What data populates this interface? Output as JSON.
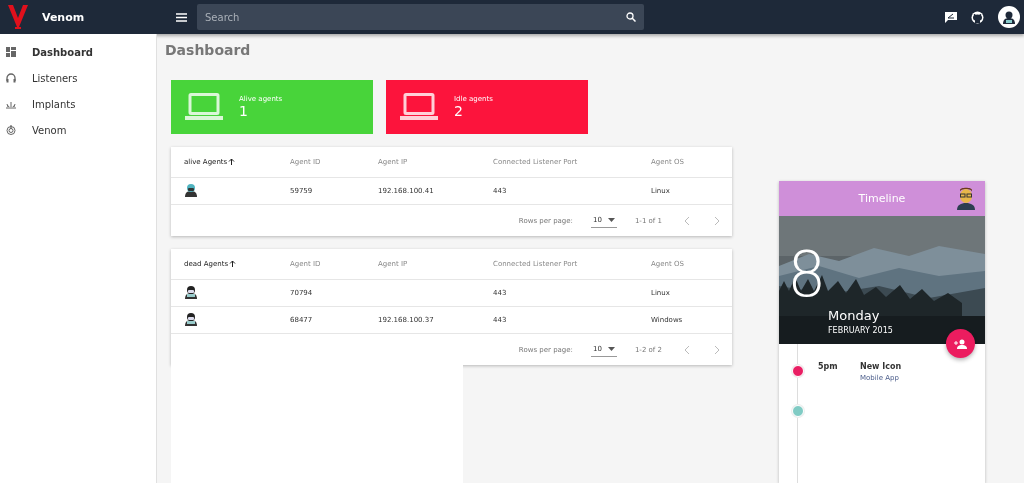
{
  "app": {
    "name": "Venom"
  },
  "search": {
    "placeholder": "Search"
  },
  "sidebar": {
    "items": [
      {
        "label": "Dashboard",
        "kind": "dashboard",
        "selected": true
      },
      {
        "label": "Listeners",
        "kind": "headphones",
        "selected": false
      },
      {
        "label": "Implants",
        "kind": "implant",
        "selected": false
      },
      {
        "label": "Venom",
        "kind": "venom",
        "selected": false
      }
    ]
  },
  "page_title": "Dashboard",
  "stat_cards": [
    {
      "label": "Alive agents",
      "value": "1",
      "color": "#48d43a"
    },
    {
      "label": "Idle agents",
      "value": "2",
      "color": "#fc143c"
    }
  ],
  "tables": [
    {
      "columns": [
        "alive Agents",
        "Agent ID",
        "Agent IP",
        "Connected Listener Port",
        "Agent OS"
      ],
      "rows": [
        {
          "id": "59759",
          "ip": "192.168.100.41",
          "port": "443",
          "os": "Linux",
          "kind": "alive"
        }
      ],
      "rows_per_page_label": "Rows per page:",
      "rows_per_page": "10",
      "range": "1-1 of 1"
    },
    {
      "columns": [
        "dead Agents",
        "Agent ID",
        "Agent IP",
        "Connected Listener Port",
        "Agent OS"
      ],
      "rows": [
        {
          "id": "70794",
          "port": "443",
          "os": "Linux",
          "kind": "dead"
        },
        {
          "id": "68477",
          "ip": "192.168.100.37",
          "port": "443",
          "os": "Windows",
          "kind": "dead"
        }
      ],
      "rows_per_page_label": "Rows per page:",
      "rows_per_page": "10",
      "range": "1-2 of 2"
    }
  ],
  "timeline": {
    "title": "Timeline",
    "day_number": "8",
    "weekday": "Monday",
    "month_year": "FEBRUARY 2015",
    "events": [
      {
        "time": "5pm",
        "title": "New Icon",
        "subtitle": "Mobile App",
        "color": "#e91e63"
      },
      {
        "color": "#80cbc4"
      }
    ]
  }
}
